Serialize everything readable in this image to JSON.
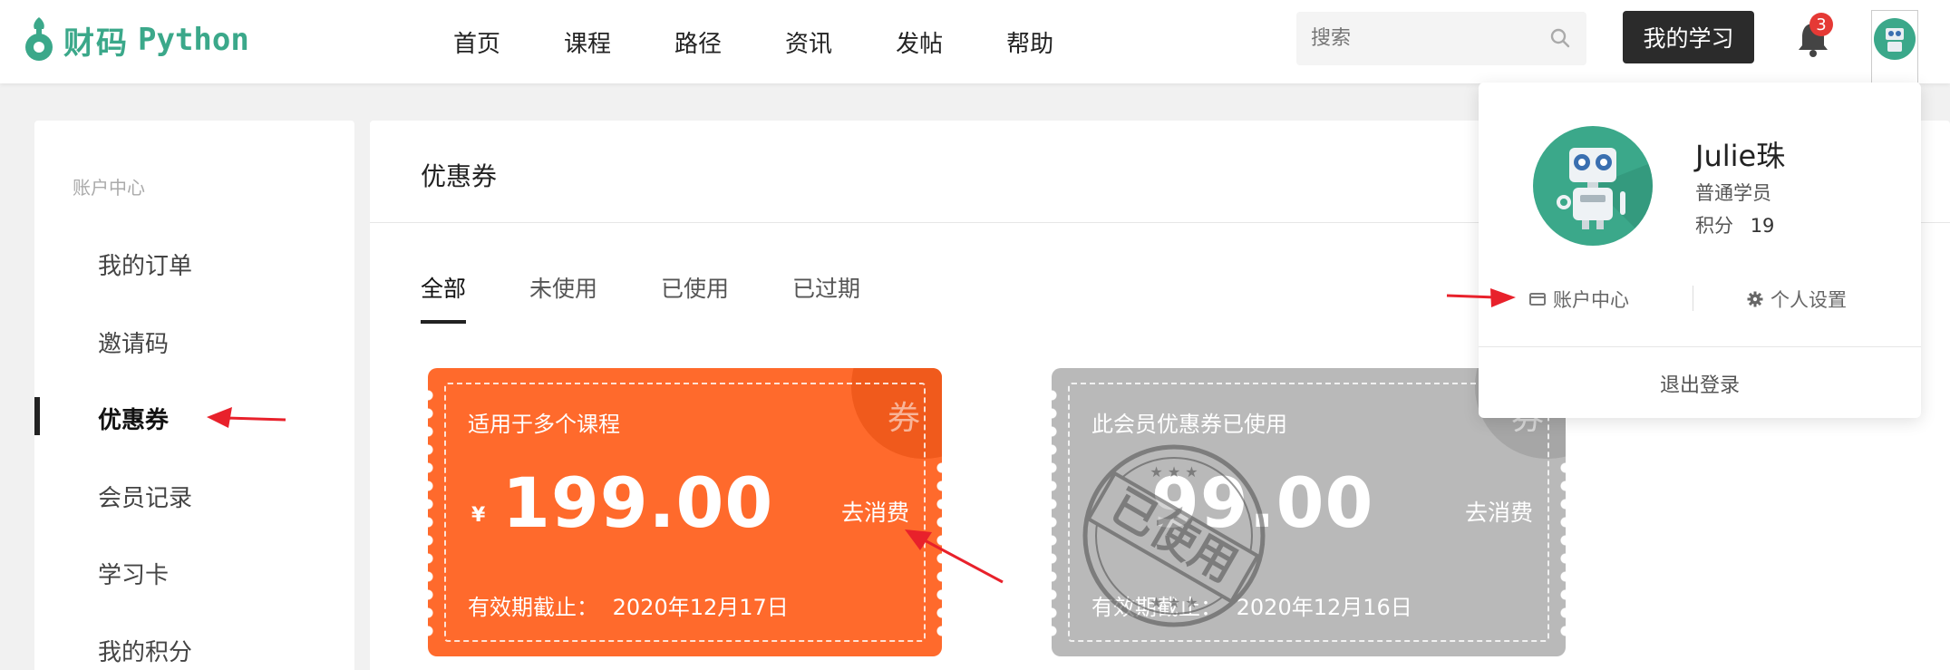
{
  "header": {
    "logo_cn": "财码",
    "logo_en": "Python",
    "nav": [
      "首页",
      "课程",
      "路径",
      "资讯",
      "发帖",
      "帮助"
    ],
    "search_placeholder": "搜索",
    "my_study_label": "我的学习",
    "notification_count": "3"
  },
  "sidebar": {
    "title": "账户中心",
    "items": [
      "我的订单",
      "邀请码",
      "优惠券",
      "会员记录",
      "学习卡",
      "我的积分"
    ],
    "active_index": 2
  },
  "main": {
    "title": "优惠券",
    "tabs": [
      "全部",
      "未使用",
      "已使用",
      "已过期"
    ],
    "active_tab": 0,
    "coupons": [
      {
        "scope": "适用于多个课程",
        "currency": "¥",
        "amount": "199.00",
        "action": "去消费",
        "expiry_label": "有效期截止：",
        "expiry_date": "2020年12月17日",
        "badge": "券",
        "color": "#ff6a2c"
      },
      {
        "scope": "此会员优惠券已使用",
        "amount": "99.00",
        "action": "去消费",
        "expiry_label": "有效期截止：",
        "expiry_date": "2020年12月16日",
        "badge": "券",
        "stamp_text": "已使用",
        "color": "#b9b9b9"
      }
    ]
  },
  "dropdown": {
    "username": "Julie珠",
    "role": "普通学员",
    "points_label": "积分",
    "points_value": "19",
    "account_center": "账户中心",
    "settings": "个人设置",
    "logout": "退出登录"
  },
  "colors": {
    "brand": "#3ba88a",
    "coupon_active": "#ff6a2c",
    "coupon_used": "#b9b9b9",
    "annotation_arrow": "#e8212b"
  }
}
